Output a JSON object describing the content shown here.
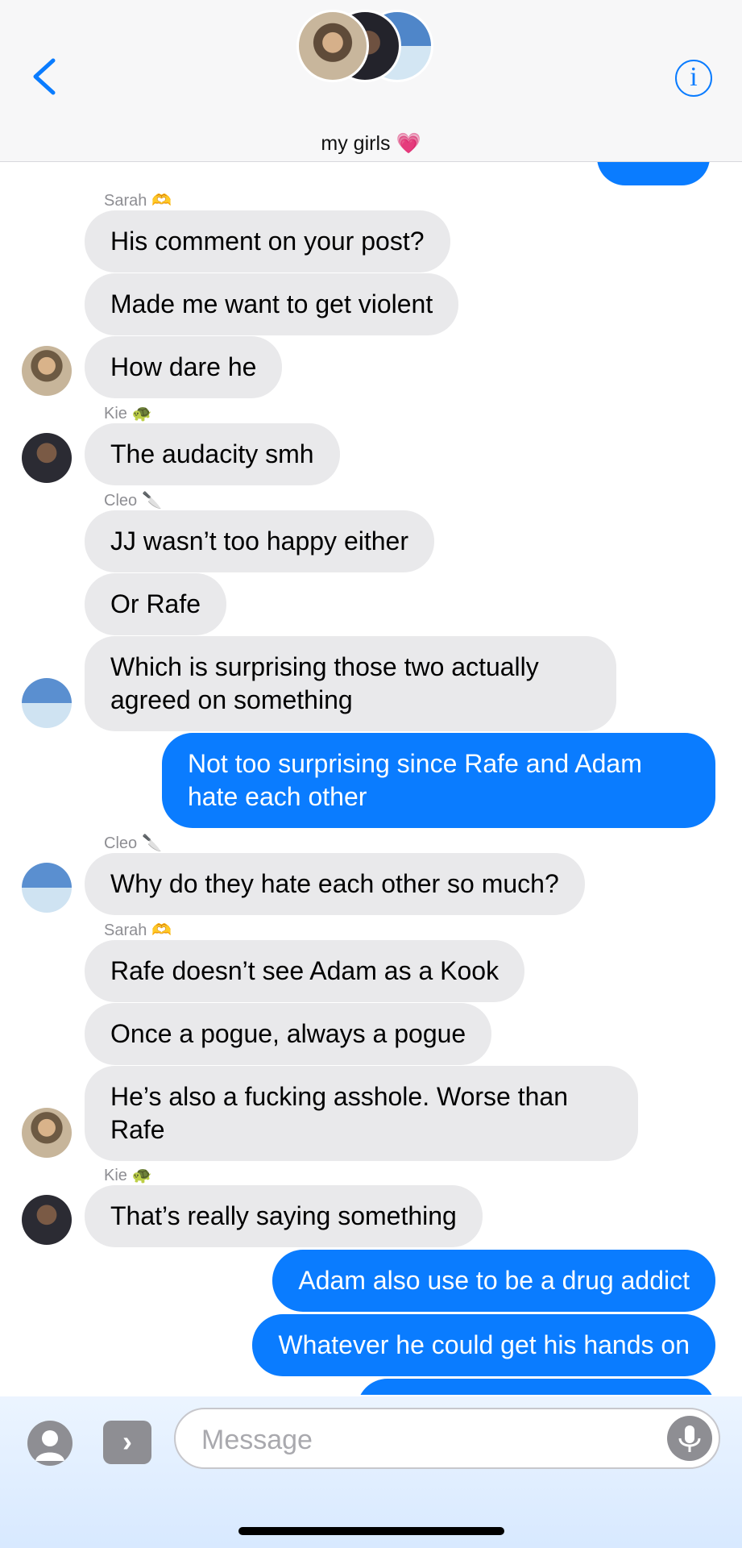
{
  "header": {
    "group_name": "my girls",
    "group_emoji": "💗"
  },
  "messages": [
    {
      "sender": "Sarah",
      "sender_emoji": "🫶",
      "text": "His comment on your post?",
      "direction": "in"
    },
    {
      "text": "Made me want to get violent",
      "direction": "in"
    },
    {
      "text": "How dare he",
      "direction": "in"
    },
    {
      "sender": "Kie",
      "sender_emoji": "🐢",
      "text": "The audacity smh",
      "direction": "in"
    },
    {
      "sender": "Cleo",
      "sender_emoji": "🔪",
      "text": "JJ wasn’t too happy either",
      "direction": "in"
    },
    {
      "text": "Or Rafe",
      "direction": "in"
    },
    {
      "text_line1": "Which is surprising those two actually",
      "text_line2": "agreed on something",
      "direction": "in"
    },
    {
      "text_line1": "Not too surprising since Rafe and Adam",
      "text_line2": "hate each other",
      "direction": "out"
    },
    {
      "sender": "Cleo",
      "sender_emoji": "🔪",
      "text": "Why do they hate each other so much?",
      "direction": "in"
    },
    {
      "sender": "Sarah",
      "sender_emoji": "🫶",
      "text": "Rafe doesn’t see Adam as a Kook",
      "direction": "in"
    },
    {
      "text": "Once a pogue, always a pogue",
      "direction": "in"
    },
    {
      "text_line1": "He’s also a fucking asshole. Worse than",
      "text_line2": "Rafe",
      "direction": "in"
    },
    {
      "sender": "Kie",
      "sender_emoji": "🐢",
      "text": "That’s really saying something",
      "direction": "in"
    },
    {
      "text": "Adam also use to be a drug addict",
      "direction": "out"
    },
    {
      "text": "Whatever he could get his hands on",
      "direction": "out"
    }
  ],
  "composer": {
    "placeholder": "Message"
  },
  "colors": {
    "outgoing_bubble": "#0a7cff",
    "incoming_bubble": "#e9e9eb",
    "accent": "#0a7cff"
  }
}
